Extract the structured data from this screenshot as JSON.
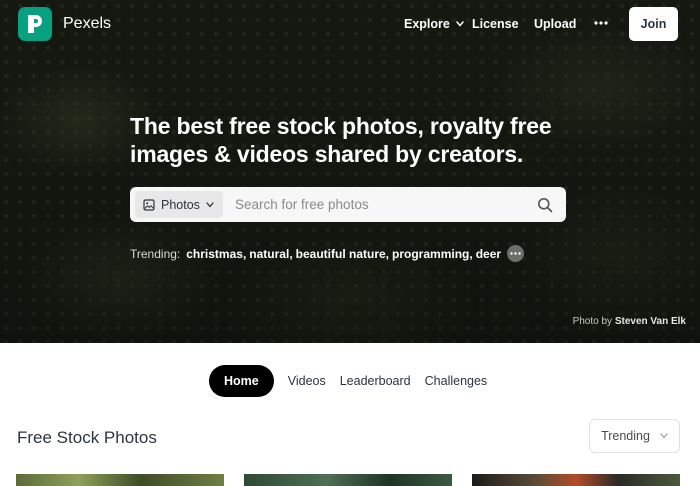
{
  "header": {
    "brand": "Pexels",
    "logo_icon": "pexels-logo-icon",
    "nav": {
      "explore": "Explore",
      "license": "License",
      "upload": "Upload",
      "join": "Join"
    }
  },
  "hero": {
    "headline": "The best free stock photos, royalty free images & videos shared by creators.",
    "search": {
      "type_label": "Photos",
      "placeholder": "Search for free photos",
      "value": ""
    },
    "trending": {
      "label": "Trending:",
      "items": [
        "christmas",
        "natural",
        "beautiful nature",
        "programming",
        "deer"
      ]
    },
    "credit": {
      "prefix": "Photo by",
      "author": "Steven Van Elk"
    }
  },
  "tabs": [
    "Home",
    "Videos",
    "Leaderboard",
    "Challenges"
  ],
  "section": {
    "title": "Free Stock Photos",
    "sort_label": "Trending"
  },
  "colors": {
    "brand": "#07a081",
    "active_tab": "#000000",
    "text": "#2c343e"
  }
}
